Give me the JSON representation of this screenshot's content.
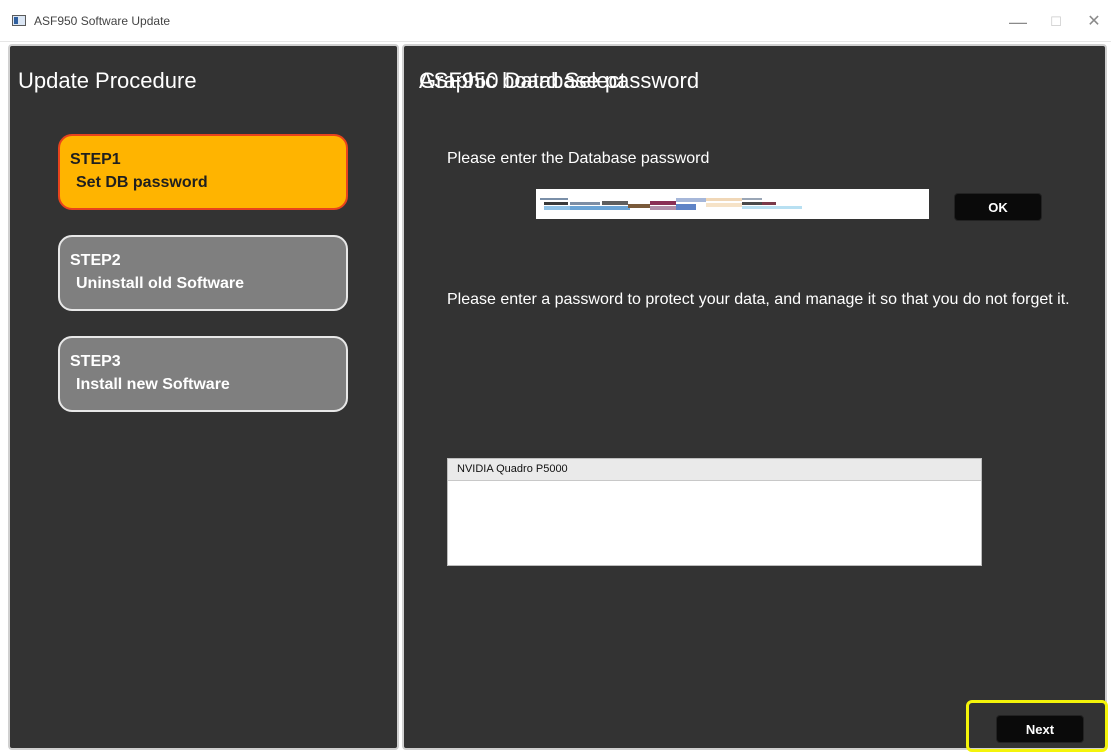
{
  "window": {
    "title": "ASF950 Software Update",
    "minimize": "—",
    "maximize": "☐",
    "close": "✕"
  },
  "left": {
    "heading": "Update Procedure",
    "steps": [
      {
        "num": "STEP1",
        "label": "Set DB password",
        "state": "active"
      },
      {
        "num": "STEP2",
        "label": "Uninstall old Software",
        "state": "inactive"
      },
      {
        "num": "STEP3",
        "label": "Install new Software",
        "state": "inactive"
      }
    ]
  },
  "right": {
    "heading": "ASF950  Database password",
    "password_prompt": "Please enter the Database password",
    "ok_label": "OK",
    "note": "Please enter a password to protect your data, and manage it so that you do not forget it.",
    "graphic_heading": "Graphic board Select",
    "graphic_boards": [
      "NVIDIA Quadro P5000"
    ],
    "next_label": "Next"
  },
  "colors": {
    "panel_bg": "#333333",
    "active_step": "#ffb400",
    "active_border": "#e8431c",
    "inactive_step": "#7f7f7f",
    "highlight": "#f4f40a"
  },
  "icons": {
    "app": "app-window-icon",
    "minimize": "minimize-icon",
    "maximize": "maximize-icon",
    "close": "close-icon"
  }
}
